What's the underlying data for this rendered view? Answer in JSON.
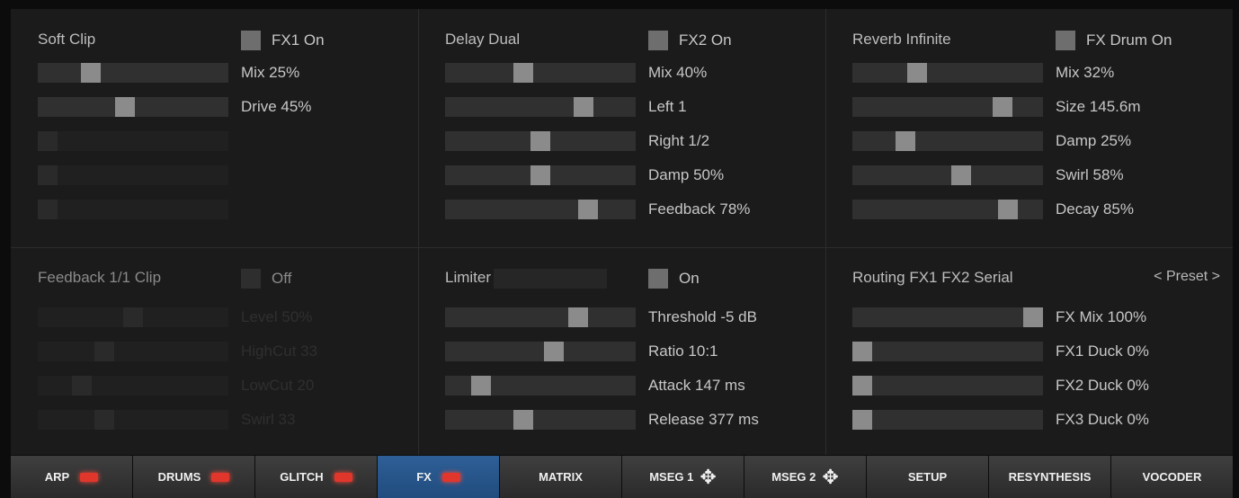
{
  "sections": [
    {
      "id": "soft-clip",
      "title": "Soft Clip",
      "toggle": {
        "label": "FX1 On",
        "on": true
      },
      "sliders": [
        {
          "label": "Mix 25%",
          "value": 0.25
        },
        {
          "label": "Drive 45%",
          "value": 0.45
        },
        {
          "label": "",
          "value": 0,
          "faint": true
        },
        {
          "label": "",
          "value": 0,
          "faint": true
        },
        {
          "label": "",
          "value": 0,
          "faint": true
        }
      ]
    },
    {
      "id": "delay-dual",
      "title": "Delay Dual",
      "toggle": {
        "label": "FX2 On",
        "on": true
      },
      "sliders": [
        {
          "label": "Mix 40%",
          "value": 0.4
        },
        {
          "label": "Left 1",
          "value": 0.75
        },
        {
          "label": "Right 1/2",
          "value": 0.5
        },
        {
          "label": "Damp 50%",
          "value": 0.5
        },
        {
          "label": "Feedback 78%",
          "value": 0.78
        }
      ]
    },
    {
      "id": "reverb-infinite",
      "title": "Reverb Infinite",
      "toggle": {
        "label": "FX Drum On",
        "on": true
      },
      "sliders": [
        {
          "label": "Mix 32%",
          "value": 0.32
        },
        {
          "label": "Size 145.6m",
          "value": 0.82
        },
        {
          "label": "Damp 25%",
          "value": 0.25
        },
        {
          "label": "Swirl 58%",
          "value": 0.58
        },
        {
          "label": "Decay 85%",
          "value": 0.85
        }
      ]
    },
    {
      "id": "feedback",
      "title": "Feedback 1/1 Clip",
      "dim": true,
      "toggle": {
        "label": "Off",
        "on": false
      },
      "sliders": [
        {
          "label": "Level 50%",
          "value": 0.5,
          "faint": true
        },
        {
          "label": "HighCut 33",
          "value": 0.33,
          "faint": true
        },
        {
          "label": "LowCut 20",
          "value": 0.2,
          "faint": true
        },
        {
          "label": "Swirl 33",
          "value": 0.33,
          "faint": true
        }
      ]
    },
    {
      "id": "limiter",
      "title": "Limiter",
      "toggle": {
        "label": "On",
        "on": true
      },
      "sliders": [
        {
          "label": "Threshold -5 dB",
          "value": 0.72
        },
        {
          "label": "Ratio 10:1",
          "value": 0.58
        },
        {
          "label": "Attack 147 ms",
          "value": 0.15
        },
        {
          "label": "Release 377 ms",
          "value": 0.4
        }
      ]
    },
    {
      "id": "routing",
      "title": "Routing FX1 FX2 Serial",
      "preset": "< Preset >",
      "sliders": [
        {
          "label": "FX Mix 100%",
          "value": 1.0
        },
        {
          "label": "FX1 Duck 0%",
          "value": 0
        },
        {
          "label": "FX2 Duck 0%",
          "value": 0
        },
        {
          "label": "FX3 Duck 0%",
          "value": 0
        }
      ]
    }
  ],
  "tabs": [
    {
      "label": "ARP",
      "indicator": "led"
    },
    {
      "label": "DRUMS",
      "indicator": "led"
    },
    {
      "label": "GLITCH",
      "indicator": "led"
    },
    {
      "label": "FX",
      "indicator": "led",
      "active": true
    },
    {
      "label": "MATRIX",
      "indicator": ""
    },
    {
      "label": "MSEG 1",
      "indicator": "move"
    },
    {
      "label": "MSEG 2",
      "indicator": "move"
    },
    {
      "label": "SETUP",
      "indicator": ""
    },
    {
      "label": "RESYNTHESIS",
      "indicator": ""
    },
    {
      "label": "VOCODER",
      "indicator": ""
    }
  ],
  "icons": {
    "move": "✥",
    "led": "led-indicator"
  },
  "colors": {
    "background": "#1b1b1b",
    "knob": "#8b8b8b",
    "track": "#303030",
    "active_tab": "#2e5f97",
    "led": "#e0362c"
  }
}
